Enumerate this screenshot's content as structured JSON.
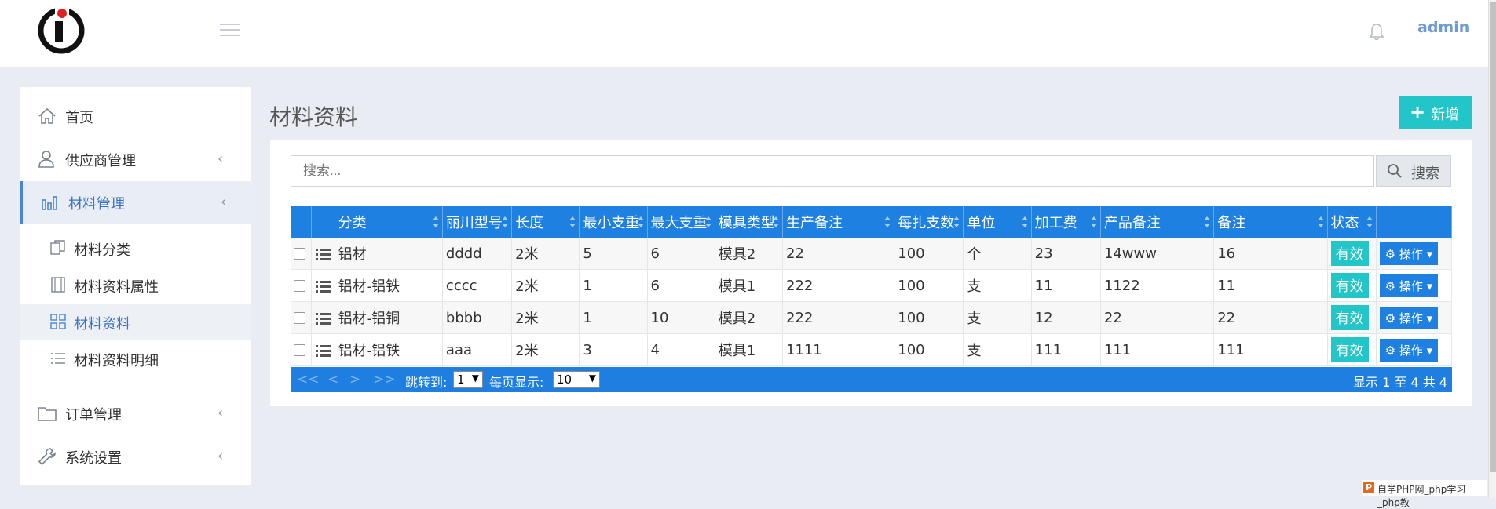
{
  "header": {
    "user": "admin",
    "icons": [
      "logo",
      "menu-icon",
      "bell-icon"
    ]
  },
  "sidebar": {
    "items": [
      {
        "label": "首页",
        "icon": "home-icon"
      },
      {
        "label": "供应商管理",
        "icon": "user-icon",
        "chevron": "‹"
      },
      {
        "label": "材料管理",
        "icon": "bar-chart-icon",
        "chevron": "‹"
      },
      {
        "label": "订单管理",
        "icon": "folder-icon",
        "chevron": "‹"
      },
      {
        "label": "系统设置",
        "icon": "wrench-icon",
        "chevron": "‹"
      }
    ],
    "subitems": [
      {
        "label": "材料分类",
        "icon": "copy-icon"
      },
      {
        "label": "材料资料属性",
        "icon": "film-icon"
      },
      {
        "label": "材料资料",
        "icon": "grid-icon"
      },
      {
        "label": "材料资料明细",
        "icon": "list-icon"
      }
    ]
  },
  "main": {
    "title": "材料资料",
    "add_label": "新增",
    "search": {
      "placeholder": "搜索...",
      "button": "搜索"
    },
    "columns": [
      "分类",
      "丽川型号",
      "长度",
      "最小支重",
      "最大支重",
      "模具类型",
      "生产备注",
      "每扎支数",
      "单位",
      "加工费",
      "产品备注",
      "备注",
      "状态"
    ],
    "rows": [
      {
        "cells": [
          "铝材",
          "dddd",
          "2米",
          "5",
          "6",
          "模具2",
          "22",
          "100",
          "个",
          "23",
          "14www",
          "16"
        ],
        "status": "有效",
        "op": "操作"
      },
      {
        "cells": [
          "铝材-铝铁",
          "cccc",
          "2米",
          "1",
          "6",
          "模具1",
          "222",
          "100",
          "支",
          "11",
          "1122",
          "11"
        ],
        "status": "有效",
        "op": "操作"
      },
      {
        "cells": [
          "铝材-铝铜",
          "bbbb",
          "2米",
          "1",
          "10",
          "模具2",
          "222",
          "100",
          "支",
          "12",
          "22",
          "22"
        ],
        "status": "有效",
        "op": "操作"
      },
      {
        "cells": [
          "铝材-铝铁",
          "aaa",
          "2米",
          "3",
          "4",
          "模具1",
          "1111",
          "100",
          "支",
          "111",
          "111",
          "111"
        ],
        "status": "有效",
        "op": "操作"
      }
    ],
    "pager": {
      "first": "<<",
      "prev": "<",
      "next": ">",
      "last": ">>",
      "jump_label": "跳转到:",
      "jump_value": "1",
      "size_label": "每页显示:",
      "size_value": "10",
      "info": "显示 1 至 4 共 4"
    }
  },
  "watermark": "自学PHP网_php学习_php教",
  "colors": {
    "accent": "#1e80e0",
    "teal": "#23c6c8",
    "active_text": "#3b74c4"
  }
}
